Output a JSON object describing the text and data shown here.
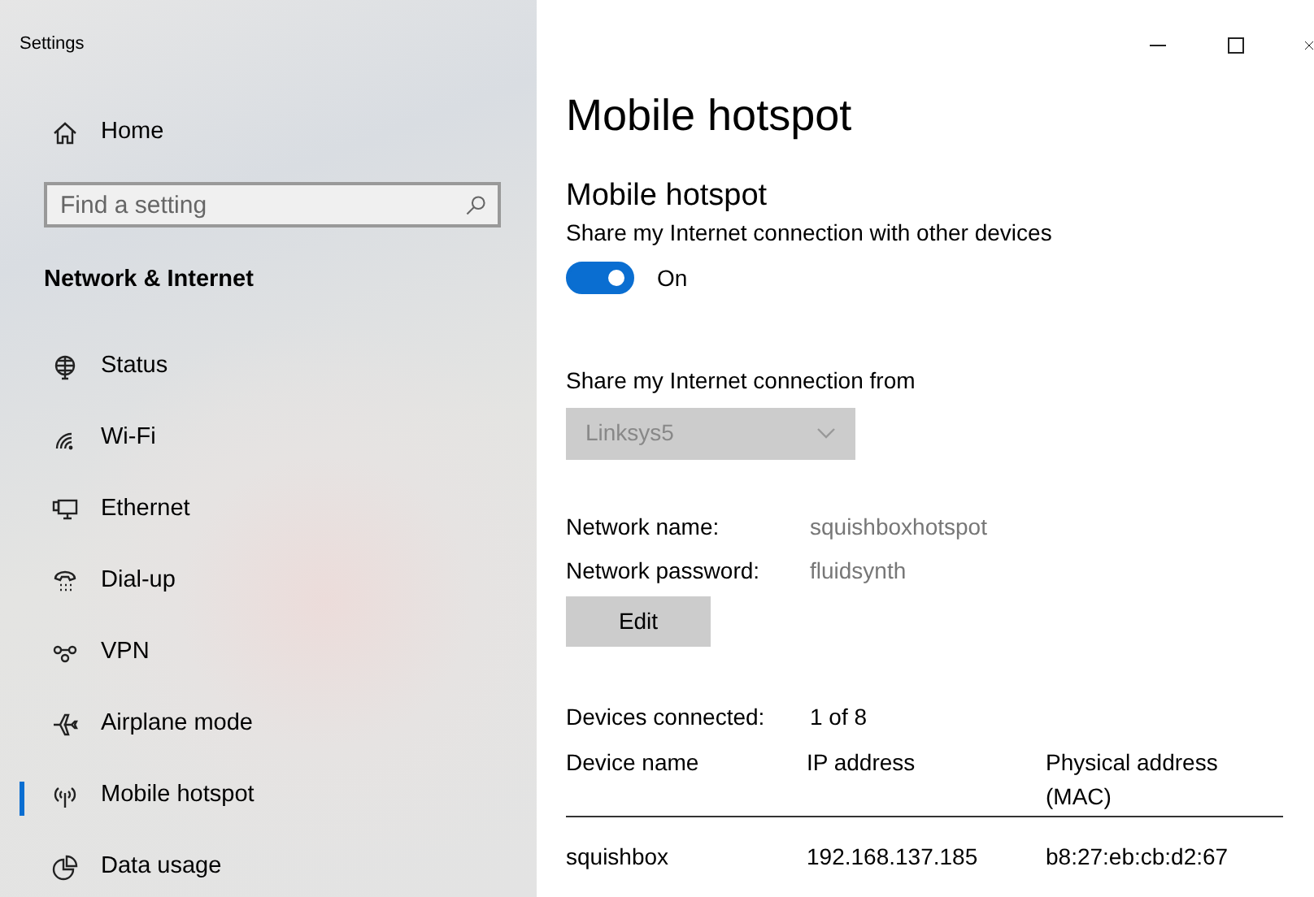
{
  "window": {
    "title": "Settings"
  },
  "sidebar": {
    "home": "Home",
    "search": {
      "placeholder": "Find a setting"
    },
    "section": "Network & Internet",
    "items": [
      {
        "label": "Status",
        "selected": false
      },
      {
        "label": "Wi-Fi",
        "selected": false
      },
      {
        "label": "Ethernet",
        "selected": false
      },
      {
        "label": "Dial-up",
        "selected": false
      },
      {
        "label": "VPN",
        "selected": false
      },
      {
        "label": "Airplane mode",
        "selected": false
      },
      {
        "label": "Mobile hotspot",
        "selected": true
      },
      {
        "label": "Data usage",
        "selected": false
      }
    ]
  },
  "main": {
    "title": "Mobile hotspot",
    "section": "Mobile hotspot",
    "description": "Share my Internet connection with other devices",
    "toggle": {
      "on": true,
      "label": "On"
    },
    "share_from": {
      "label": "Share my Internet connection from",
      "value": "Linksys5",
      "disabled": true
    },
    "fields": [
      {
        "label": "Network name:",
        "value": "squishboxhotspot"
      },
      {
        "label": "Network password:",
        "value": "fluidsynth"
      }
    ],
    "edit_button": "Edit",
    "devices_connected": {
      "label": "Devices connected:",
      "value": "1 of 8"
    },
    "table": {
      "columns": [
        "Device name",
        "IP address",
        "Physical address (MAC)"
      ],
      "rows": [
        [
          "squishbox",
          "192.168.137.185",
          "b8:27:eb:cb:d2:67"
        ]
      ]
    }
  }
}
